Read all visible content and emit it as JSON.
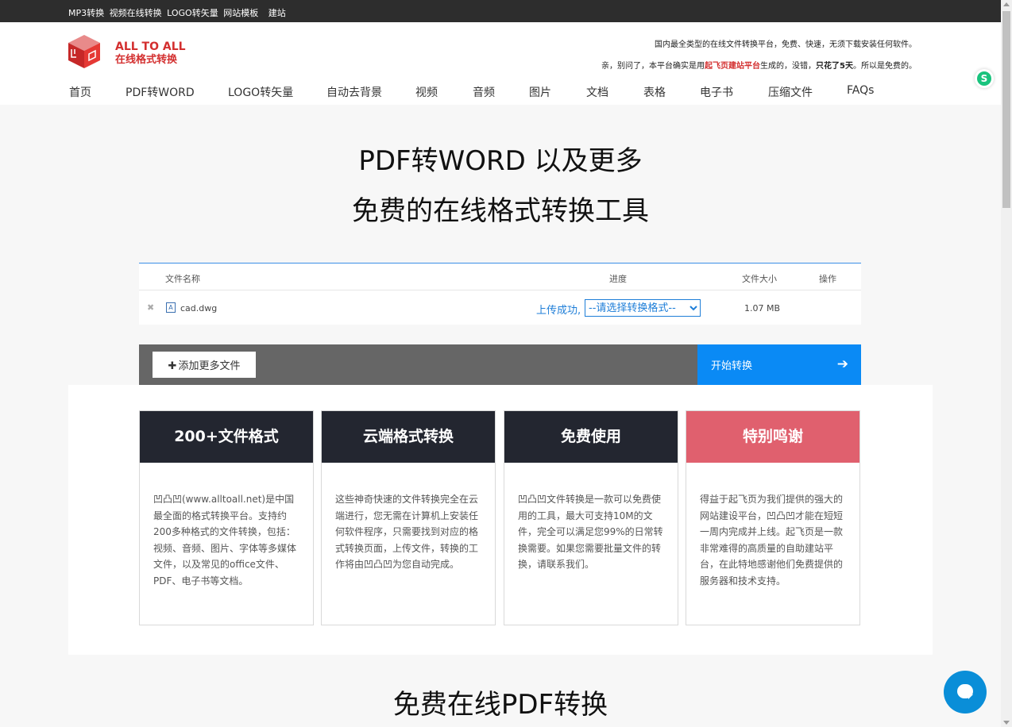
{
  "topbar": {
    "links": [
      "MP3转换",
      "视频在线转换",
      "LOGO转矢量",
      "网站模板",
      "建站"
    ]
  },
  "header": {
    "brand_en": "ALL TO ALL",
    "brand_cn": "在线格式转换",
    "slogan1": "国内最全类型的在线文件转换平台，免费、快速，无须下载安装任何软件。",
    "slogan2_pre": "亲，别问了，本平台确实是用",
    "slogan2_red": "起飞页建站平台",
    "slogan2_mid": "生成的，没错，",
    "slogan2_bold": "只花了5天",
    "slogan2_post": "。所以是免费的。"
  },
  "nav": [
    "首页",
    "PDF转WORD",
    "LOGO转矢量",
    "自动去背景",
    "视频",
    "音频",
    "图片",
    "文档",
    "表格",
    "电子书",
    "压缩文件",
    "FAQs"
  ],
  "hero": {
    "line1": "PDF转WORD 以及更多",
    "line2": "免费的在线格式转换工具"
  },
  "filetable": {
    "headers": {
      "name": "文件名称",
      "progress": "进度",
      "size": "文件大小",
      "action": "操作"
    },
    "row": {
      "remove": "✖",
      "icon": "A",
      "filename": "cad.dwg",
      "status": "上传成功,",
      "select_value": "--请选择转换格式--",
      "size": "1.07 MB"
    }
  },
  "actions": {
    "add_plus": "✚",
    "add_label": "添加更多文件",
    "start_label": "开始转换",
    "start_arrow": "➔"
  },
  "features": [
    {
      "title": "200+文件格式",
      "body": "凹凸凹(www.alltoall.net)是中国最全面的格式转换平台。支持约200多种格式的文件转换，包括：视频、音频、图片、字体等多媒体文件，以及常见的office文件、PDF、电子书等文档。"
    },
    {
      "title": "云端格式转换",
      "body": "这些神奇快速的文件转换完全在云端进行，您无需在计算机上安装任何软件程序，只需要找到对应的格式转换页面，上传文件，转换的工作将由凹凸凹为您自动完成。"
    },
    {
      "title": "免费使用",
      "body": "凹凸凹文件转换是一款可以免费使用的工具，最大可支持10M的文件，完全可以满足您99%的日常转换需要。如果您需要批量文件的转换，请联系我们。"
    },
    {
      "title": "特别鸣谢",
      "body": "得益于起飞页为我们提供的强大的网站建设平台，凹凸凹才能在短短一周内完成并上线。起飞页是一款非常难得的高质量的自助建站平台，在此特地感谢他们免费提供的服务器和技术支持。"
    }
  ],
  "bottom": {
    "title": "免费在线PDF转换"
  },
  "widgets": {
    "green_badge": "S"
  },
  "colors": {
    "brand_red": "#d32f2f",
    "accent_blue": "#0a8af5",
    "dark_card": "#232630",
    "pink_card": "#e0606e"
  }
}
